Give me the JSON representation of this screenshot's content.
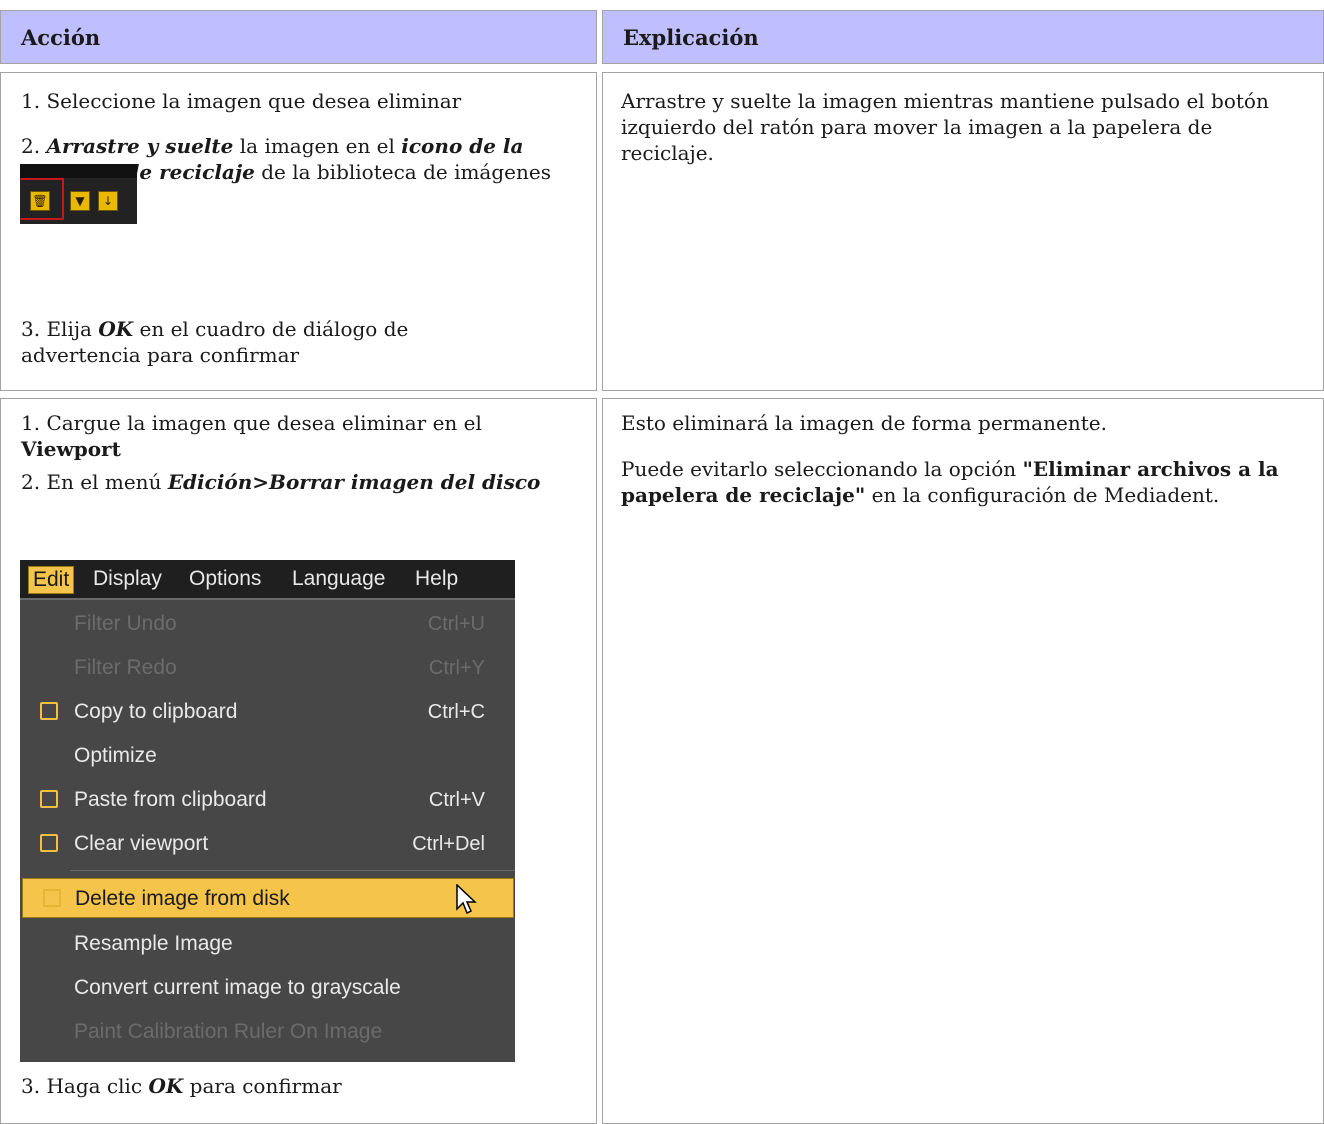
{
  "table": {
    "headers": [
      "Acción",
      "Explicación"
    ],
    "row1": {
      "steps": [
        {
          "num": "1.",
          "text": "Seleccione la imagen que desea eliminar"
        },
        {
          "num": "2.",
          "bold_italic_1": "Arrastre y suelte",
          "text_1": " la imagen en el ",
          "bold_italic_2": "icono de la papelera de reciclaje",
          "text_2": " de la biblioteca de imágenes"
        },
        {
          "num": "3.",
          "text_1": "Elija ",
          "bold_italic": "OK",
          "text_2": " en el cuadro de diálogo de advertencia para confirmar"
        }
      ],
      "explanation": "Arrastre y suelte la imagen mientras mantiene pulsado el botón izquierdo del ratón para mover la imagen a la papelera de reciclaje."
    },
    "row2": {
      "steps": [
        {
          "num": "1.",
          "text": "Cargue la imagen que desea eliminar en el ",
          "bold": "Viewport"
        },
        {
          "num": "2.",
          "text": "En el menú ",
          "bold_italic": "Edición>Borrar imagen del disco"
        },
        {
          "num": "3.",
          "text_1": "Haga clic ",
          "bold_italic": "OK",
          "text_2": " para confirmar"
        }
      ],
      "explanation_1": "Esto eliminará la imagen de forma permanente.",
      "explanation_2_text_1": "Puede evitarlo seleccionando la opción ",
      "explanation_2_bold": "\"Eliminar archivos a la papelera de reciclaje\"",
      "explanation_2_text_2": " en la configuración de Mediadent."
    }
  },
  "toolbar_image": {
    "icons": [
      "trash-icon",
      "filter-icon",
      "download-arrow-icon"
    ],
    "highlight_color": "#c21a1a"
  },
  "menu_image": {
    "menubar": [
      "Edit",
      "Display",
      "Options",
      "Language",
      "Help"
    ],
    "active_menu": "Edit",
    "items": [
      {
        "label": "Filter Undo",
        "shortcut": "Ctrl+U",
        "disabled": true
      },
      {
        "label": "Filter Redo",
        "shortcut": "Ctrl+Y",
        "disabled": true
      },
      {
        "label": "Copy to clipboard",
        "shortcut": "Ctrl+C",
        "icon": "copy-icon"
      },
      {
        "label": "Optimize",
        "shortcut": ""
      },
      {
        "label": "Paste from clipboard",
        "shortcut": "Ctrl+V",
        "icon": "paste-icon"
      },
      {
        "label": "Clear viewport",
        "shortcut": "Ctrl+Del",
        "icon": "clear-icon"
      },
      {
        "label": "Delete image from disk",
        "shortcut": "",
        "highlighted": true,
        "icon": "delete-icon"
      },
      {
        "label": "Resample Image",
        "shortcut": ""
      },
      {
        "label": "Convert current image to grayscale",
        "shortcut": ""
      },
      {
        "label": "Paint Calibration Ruler On Image",
        "shortcut": "",
        "disabled": true
      }
    ],
    "highlight_color": "#f4c54a",
    "background_color": "#474747"
  }
}
